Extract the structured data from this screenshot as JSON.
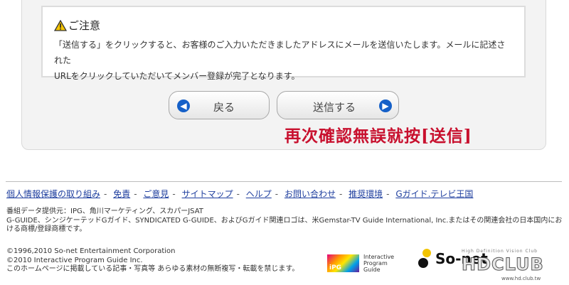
{
  "notice": {
    "title": "ご注意",
    "line1": "「送信する」をクリックすると、お客様のご入力いただきましたアドレスにメールを送信いたします。メールに記述された",
    "line2": "URLをクリックしていただいてメンバー登録が完了となります。"
  },
  "buttons": {
    "back_label": "戻る",
    "send_label": "送信する"
  },
  "overlay": {
    "text": "再次確認無誤就按[送信]",
    "color": "#c8102e"
  },
  "footer": {
    "links": [
      "個人情報保護の取り組み",
      "免責",
      "ご意見",
      "サイトマップ",
      "ヘルプ",
      "お問い合わせ",
      "推奨環境",
      "Gガイド.テレビ王国"
    ],
    "separator": "-",
    "data_note_1": "番組データ提供元：IPG、角川マーケティング、スカパーJSAT",
    "data_note_2": "G-GUIDE、シンジケーテッドGガイド、SYNDICATED G-GUIDE、およびGガイド関連ロゴは、米Gemstar-TV Guide International, Inc.またはその関連会社の日本国内にお",
    "data_note_3": "ける商標/登録商標です。",
    "copyright_1": "©1996,2010 So-net Entertainment Corporation",
    "copyright_2": "©2010 Interactive Program Guide Inc.",
    "copyright_3": "このホームページに掲載している記事・写真等 あらゆる素材の無断複写・転載を禁じます。"
  },
  "logos": {
    "ipg_mark": "iPG",
    "ipg_text_1": "Interactive",
    "ipg_text_2": "Program",
    "ipg_text_3": "Guide",
    "sonet": "So-net",
    "hdclub_tagline": "High Definition Vision Club",
    "hdclub": "HDCLUB",
    "hdclub_url": "www.hd.club.tw"
  },
  "colors": {
    "link": "#1f3f9f",
    "button_arrow": "#1560c8",
    "panel_bg": "#f3f3f3"
  }
}
